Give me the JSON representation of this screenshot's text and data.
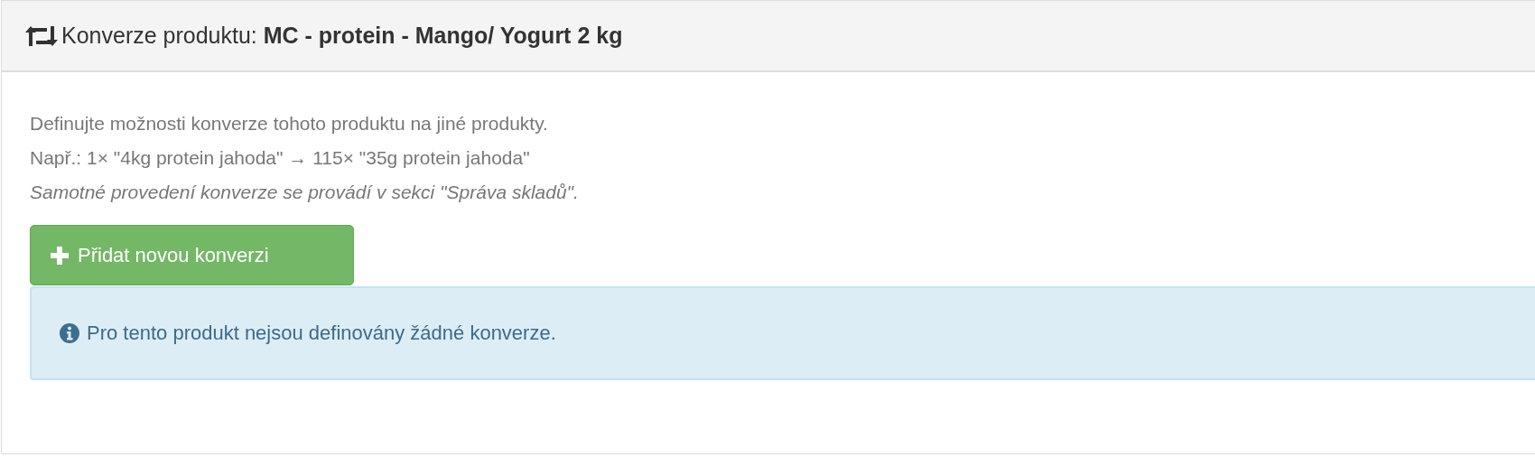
{
  "panel": {
    "title": "Konverze produktu: **MC - protein - Mango/ Yogurt 2 kg**",
    "description": [
      {
        "kind": "plain",
        "text": "Definujte možnosti konverze tohoto produktu na jiné produkty."
      },
      {
        "kind": "plain",
        "text": "Např.: 1× \"4kg protein jahoda\" → 115× \"35g protein jahoda\""
      },
      {
        "kind": "italic",
        "text": "Samotné provedení konverze se provádí v sekci \"Správa skladů\"."
      }
    ],
    "add_button": {
      "label": "Přidat novou konverzi"
    },
    "alert": {
      "kind": "info",
      "text": "Pro tento produkt nejsou definovány žádné konverze."
    }
  }
}
